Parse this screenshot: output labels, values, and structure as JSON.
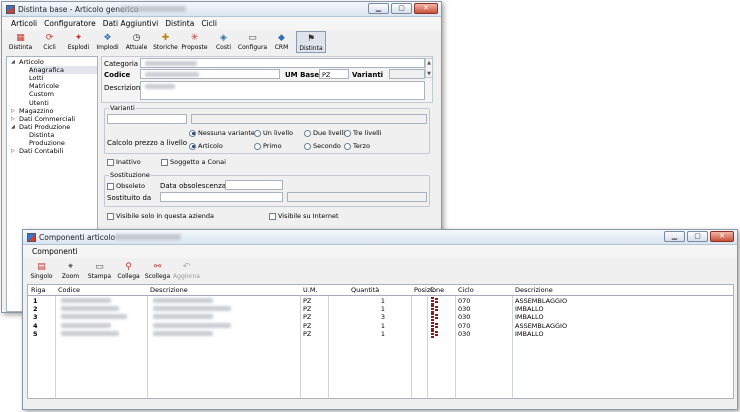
{
  "main_window": {
    "title": "Distinta base - Articolo generico",
    "menu": [
      "Articoli",
      "Configuratore",
      "Dati Aggiuntivi",
      "Distinta",
      "Cicli"
    ],
    "toolbar": [
      {
        "label": "Distinta",
        "icon": "bom-icon"
      },
      {
        "label": "Cicli",
        "icon": "cycles-icon"
      },
      {
        "label": "Esplodi",
        "icon": "explode-icon"
      },
      {
        "label": "Implodi",
        "icon": "implode-icon"
      },
      {
        "label": "Attuale",
        "icon": "clock-icon"
      },
      {
        "label": "Storiche",
        "icon": "history-icon"
      },
      {
        "label": "Proposte",
        "icon": "proposals-icon"
      },
      {
        "label": "Costi",
        "icon": "costs-icon"
      },
      {
        "label": "Configura",
        "icon": "configure-icon"
      },
      {
        "label": "CRM",
        "icon": "crm-icon"
      },
      {
        "label": "Distinta",
        "icon": "flag-icon",
        "active": true
      }
    ],
    "tree": [
      {
        "label": "Articolo",
        "level": 0,
        "toggle": "-"
      },
      {
        "label": "Anagrafica",
        "level": 1,
        "selected": true
      },
      {
        "label": "Lotti",
        "level": 1
      },
      {
        "label": "Matricole",
        "level": 1
      },
      {
        "label": "Custom",
        "level": 1
      },
      {
        "label": "Utenti",
        "level": 1
      },
      {
        "label": "Magazzino",
        "level": 0,
        "toggle": "+"
      },
      {
        "label": "Dati Commerciali",
        "level": 0,
        "toggle": "+"
      },
      {
        "label": "Dati Produzione",
        "level": 0,
        "toggle": "-"
      },
      {
        "label": "Distinta",
        "level": 1
      },
      {
        "label": "Produzione",
        "level": 1
      },
      {
        "label": "Dati Contabili",
        "level": 0,
        "toggle": "+"
      }
    ],
    "form": {
      "categoria_label": "Categoria",
      "codice_label": "Codice",
      "um_base_label": "UM Base",
      "um_base_value": "PZ",
      "varianti_label": "Varianti",
      "descrizione_label": "Descrizione",
      "varianti_group": "Varianti",
      "calcolo_label": "Calcolo prezzo a livello",
      "radio_row1": [
        {
          "label": "Nessuna variante",
          "checked": true
        },
        {
          "label": "Un livello",
          "checked": false
        },
        {
          "label": "Due livelli",
          "checked": false
        },
        {
          "label": "Tre livelli",
          "checked": false
        }
      ],
      "radio_row2": [
        {
          "label": "Articolo",
          "checked": true
        },
        {
          "label": "Primo",
          "checked": false
        },
        {
          "label": "Secondo",
          "checked": false
        },
        {
          "label": "Terzo",
          "checked": false
        }
      ],
      "inattivo_label": "Inattivo",
      "conai_label": "Soggetto a Conai",
      "sostituzione_group": "Sostituzione",
      "obsoleto_label": "Obsoleto",
      "data_obs_label": "Data obsolescenza",
      "sostituito_label": "Sostituito da",
      "visibile_azienda_label": "Visibile solo in questa azienda",
      "visibile_internet_label": "Visibile su Internet"
    }
  },
  "components_window": {
    "title": "Componenti articolo",
    "menu": [
      "Componenti"
    ],
    "toolbar": [
      {
        "label": "Singolo",
        "icon": "single-icon",
        "enabled": true
      },
      {
        "label": "Zoom",
        "icon": "zoom-icon",
        "enabled": true
      },
      {
        "label": "Stampa",
        "icon": "print-icon",
        "enabled": true
      },
      {
        "label": "Collega",
        "icon": "link-icon",
        "enabled": true
      },
      {
        "label": "Scollega",
        "icon": "unlink-icon",
        "enabled": true
      },
      {
        "label": "Aggiorna",
        "icon": "refresh-icon",
        "enabled": false
      }
    ],
    "columns": [
      "Riga",
      "Codice",
      "Descrizione",
      "U.M.",
      "Quantità",
      "Posizione",
      "C",
      "Ciclo",
      "Descrizione"
    ],
    "rows": [
      {
        "riga": "1",
        "um": "PZ",
        "quantita": "1",
        "ciclo": "070",
        "descr_ciclo": "ASSEMBLAGGIO"
      },
      {
        "riga": "2",
        "um": "PZ",
        "quantita": "1",
        "ciclo": "030",
        "descr_ciclo": "IMBALLO"
      },
      {
        "riga": "3",
        "um": "PZ",
        "quantita": "3",
        "ciclo": "030",
        "descr_ciclo": "IMBALLO"
      },
      {
        "riga": "4",
        "um": "PZ",
        "quantita": "1",
        "ciclo": "070",
        "descr_ciclo": "ASSEMBLAGGIO"
      },
      {
        "riga": "5",
        "um": "PZ",
        "quantita": "1",
        "ciclo": "030",
        "descr_ciclo": "IMBALLO"
      }
    ]
  }
}
